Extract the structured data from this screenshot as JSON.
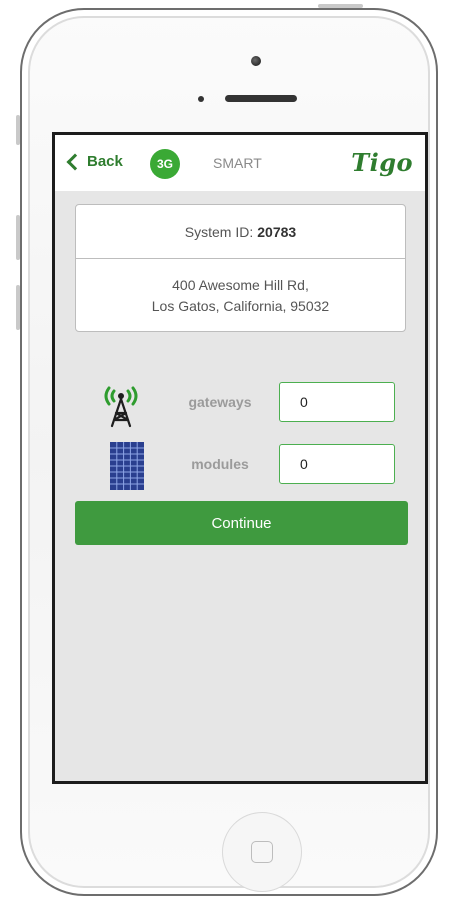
{
  "header": {
    "back_label": "Back",
    "network_badge": "3G",
    "mode_label": "SMART",
    "logo": "Tigo"
  },
  "system": {
    "id_label": "System ID:",
    "id_value": "20783",
    "address_line1": "400 Awesome Hill Rd,",
    "address_line2": "Los Gatos, California, 95032"
  },
  "fields": {
    "gateways": {
      "label": "gateways",
      "value": "0",
      "icon": "radio-tower-icon"
    },
    "modules": {
      "label": "modules",
      "value": "0",
      "icon": "solar-panel-icon"
    }
  },
  "actions": {
    "continue_label": "Continue"
  },
  "colors": {
    "brand_green": "#3f9a3f",
    "badge_green": "#3aa935",
    "input_border": "#4caf50",
    "screen_bg": "#e6e6e6"
  }
}
